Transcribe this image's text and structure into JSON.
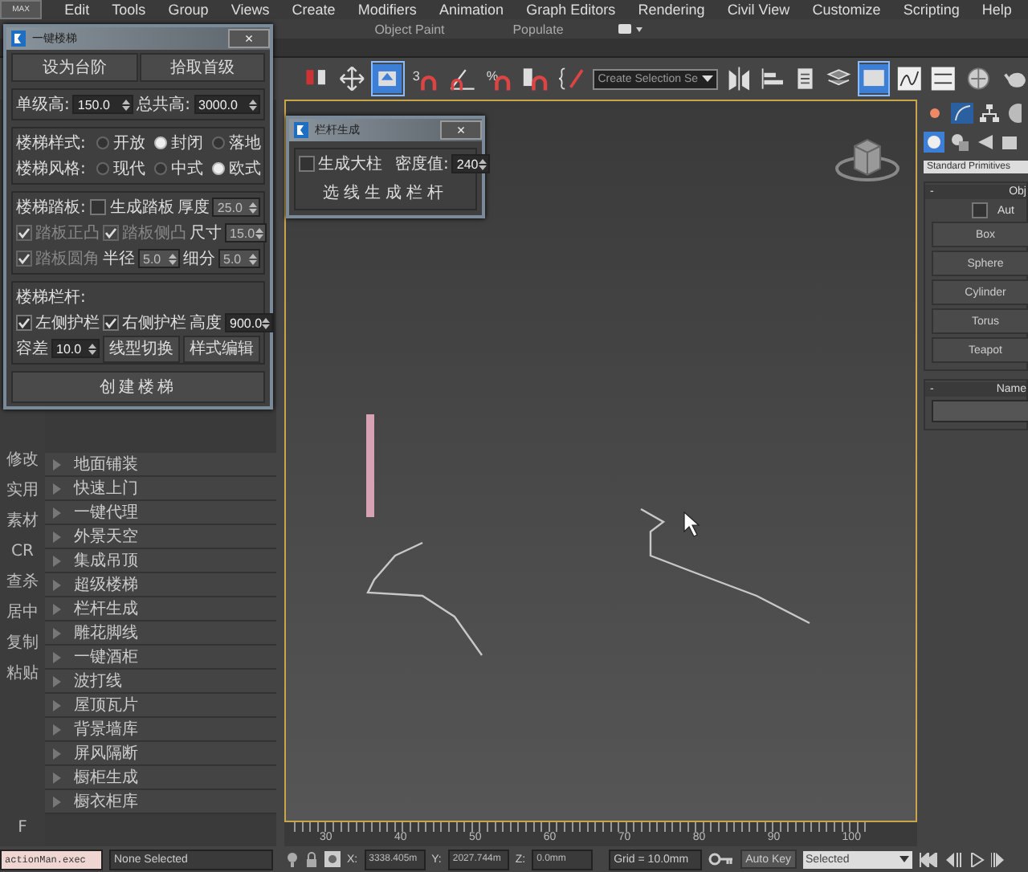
{
  "menu_bar": {
    "logo": "MAX",
    "items": [
      "Edit",
      "Tools",
      "Group",
      "Views",
      "Create",
      "Modifiers",
      "Animation",
      "Graph Editors",
      "Rendering",
      "Civil View",
      "Customize",
      "Scripting",
      "Help"
    ]
  },
  "ribbon_tabs": [
    "Object Paint",
    "Populate"
  ],
  "toolbar": {
    "selection_set": "Create Selection Se",
    "snap_labels": [
      "3",
      "%"
    ]
  },
  "side_tools": [
    "修改",
    "实用",
    "素材",
    "CR",
    "查杀",
    "居中",
    "复制",
    "粘贴"
  ],
  "side_bottom": "F",
  "script_list": [
    "地面铺装",
    "快速上门",
    "一键代理",
    "外景天空",
    "集成吊顶",
    "超级楼梯",
    "栏杆生成",
    "雕花脚线",
    "一键酒柜",
    "波打线",
    "屋顶瓦片",
    "背景墙库",
    "屏风隔断",
    "橱柜生成",
    "橱衣柜库"
  ],
  "ruler": [
    "30",
    "40",
    "50",
    "60",
    "70",
    "80",
    "90",
    "100"
  ],
  "command_panel": {
    "category": "Standard Primitives",
    "object_type": {
      "toggle": "-",
      "title": "Obj",
      "autogrid": {
        "label": "Aut",
        "checked": false
      },
      "buttons": [
        "Box",
        "Sphere",
        "Cylinder",
        "Torus",
        "Teapot"
      ]
    },
    "name_rollout": {
      "toggle": "-",
      "title": "Name"
    }
  },
  "status_bar": {
    "script_field": "actionMan.exec",
    "prompt": "None Selected",
    "coords": [
      {
        "label": "X:",
        "value": "3338.405m"
      },
      {
        "label": "Y:",
        "value": "2027.744m"
      },
      {
        "label": "Z:",
        "value": "0.0mm"
      }
    ],
    "grid": "Grid = 10.0mm",
    "auto_key": "Auto Key",
    "key_filter": "Selected"
  },
  "stair_dialog": {
    "title": "一键楼梯",
    "close": "×",
    "top_buttons": [
      "设为台阶",
      "拾取首级"
    ],
    "heights": [
      {
        "label": "单级高:",
        "value": "150.0"
      },
      {
        "label": "总共高:",
        "value": "3000.0"
      }
    ],
    "radio_groups": [
      {
        "label": "楼梯样式:",
        "options": [
          {
            "label": "开放",
            "selected": false
          },
          {
            "label": "封闭",
            "selected": true
          },
          {
            "label": "落地",
            "selected": false
          }
        ]
      },
      {
        "label": "楼梯风格:",
        "options": [
          {
            "label": "现代",
            "selected": false
          },
          {
            "label": "中式",
            "selected": false
          },
          {
            "label": "欧式",
            "selected": true
          }
        ]
      }
    ],
    "sections": [
      {
        "rows": [
          [
            {
              "kind": "label",
              "label": "楼梯踏板:"
            },
            {
              "kind": "checkbox",
              "label": "生成踏板",
              "checked": false,
              "disabled": false
            },
            {
              "kind": "spinner",
              "label": "厚度",
              "value": "25.0",
              "disabled": true
            }
          ],
          [
            {
              "kind": "checkbox",
              "label": "踏板正凸",
              "checked": true,
              "disabled": true
            },
            {
              "kind": "checkbox",
              "label": "踏板侧凸",
              "checked": true,
              "disabled": true
            },
            {
              "kind": "spinner",
              "label": "尺寸",
              "value": "15.0",
              "disabled": true
            }
          ],
          [
            {
              "kind": "checkbox",
              "label": "踏板圆角",
              "checked": true,
              "disabled": true
            },
            {
              "kind": "spinner",
              "label": "半径",
              "value": "5.0",
              "disabled": true
            },
            {
              "kind": "spinner",
              "label": "细分",
              "value": "5.0",
              "disabled": true
            }
          ]
        ]
      },
      {
        "rows": [
          [
            {
              "kind": "label",
              "label": "楼梯栏杆:"
            }
          ],
          [
            {
              "kind": "checkbox",
              "label": "左侧护栏",
              "checked": true,
              "disabled": false
            },
            {
              "kind": "checkbox",
              "label": "右侧护栏",
              "checked": true,
              "disabled": false
            },
            {
              "kind": "spinner",
              "label": "高度",
              "value": "900.0",
              "disabled": false
            }
          ],
          [
            {
              "kind": "spinner",
              "label": "容差",
              "value": "10.0",
              "disabled": false
            },
            {
              "kind": "button",
              "label": "线型切换"
            },
            {
              "kind": "button",
              "label": "样式编辑"
            }
          ]
        ]
      }
    ],
    "create_button": "创建楼梯"
  },
  "railing_dialog": {
    "title": "栏杆生成",
    "close": "×",
    "pillar": {
      "label": "生成大柱",
      "checked": false
    },
    "density": {
      "label": "密度值:",
      "value": "240"
    },
    "button": "选线生成栏杆"
  }
}
